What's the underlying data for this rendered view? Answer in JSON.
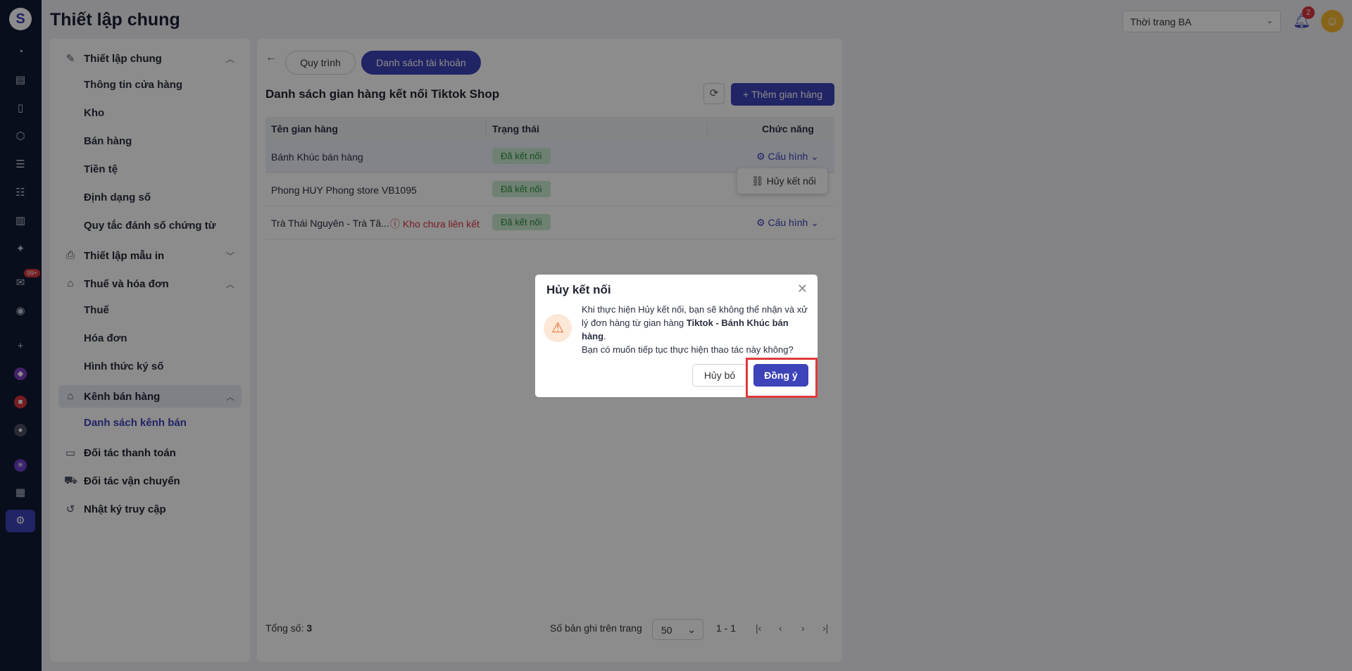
{
  "header": {
    "title": "Thiết lập chung",
    "shop_select": "Thời trang BA",
    "notification_count": "2"
  },
  "rail": {
    "badge": "99+"
  },
  "settings_nav": {
    "groups": [
      {
        "label": "Thiết lập chung"
      },
      {
        "label": "Thiết lập mẫu in"
      },
      {
        "label": "Thuế và hóa đơn"
      },
      {
        "label": "Kênh bán hàng"
      },
      {
        "label": "Đối tác thanh toán"
      },
      {
        "label": "Đối tác vận chuyển"
      },
      {
        "label": "Nhật ký truy cập"
      }
    ],
    "subs": [
      "Thông tin cửa hàng",
      "Kho",
      "Bán hàng",
      "Tiền tệ",
      "Định dạng số",
      "Quy tắc đánh số chứng từ",
      "Thuế",
      "Hóa đơn",
      "Hình thức ký số",
      "Danh sách kênh bán"
    ]
  },
  "main": {
    "tabs": [
      "Quy trình",
      "Danh sách tài khoản"
    ],
    "section_title": "Danh sách gian hàng kết nối Tiktok Shop",
    "add_button": "+ Thêm gian hàng",
    "columns": [
      "Tên gian hàng",
      "Trạng thái",
      "Chức năng"
    ],
    "rows": [
      {
        "name": "Bánh Khúc bán hàng",
        "status": "Đã kết nối",
        "action": "Cấu hình",
        "warning": ""
      },
      {
        "name": "Phong HUY Phong store VB1095",
        "status": "Đã kết nối",
        "action": "",
        "warning": ""
      },
      {
        "name": "Trà Thái Nguyên - Trà Tâ...",
        "status": "Đã kết nối",
        "action": "Cấu hình",
        "warning": "Kho chưa liên kết"
      }
    ],
    "dropdown_item": "Hủy kết nối",
    "footer": {
      "total_label": "Tổng số:",
      "total_value": "3",
      "per_page_label": "Số bản ghi trên trang",
      "per_page_value": "50",
      "range": "1 - 1"
    }
  },
  "dialog": {
    "title": "Hủy kết nối",
    "body_1": "Khi thực hiện Hủy kết nối, bạn sẽ không thể nhận và xử lý đơn hàng từ gian hàng ",
    "body_bold": "Tiktok - Bánh Khúc bán hàng",
    "body_2": ".",
    "body_3": "Bạn có muốn tiếp tục thực hiện thao tác này không?",
    "cancel": "Hủy bỏ",
    "confirm": "Đồng ý"
  }
}
